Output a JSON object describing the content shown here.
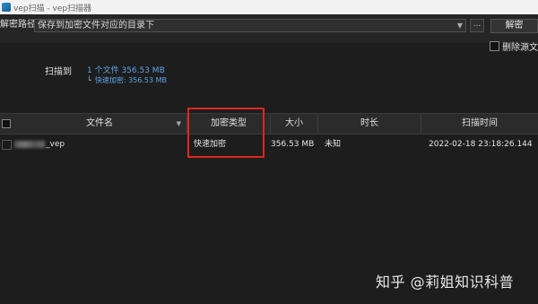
{
  "window": {
    "title": "vep扫描 - vep扫描器"
  },
  "toolbar": {
    "path_label": "解密路径",
    "path_value": "保存到加密文件对应的目录下",
    "browse_label": "...",
    "decrypt_label": "解密",
    "delete_source_label": "删除源文件"
  },
  "scan": {
    "label": "扫描到",
    "summary": "1 个文件   356.53 MB",
    "fast_encrypt": "快速加密: 356.53 MB"
  },
  "table": {
    "columns": [
      "文件名",
      "加密类型",
      "大小",
      "时长",
      "扫描时间"
    ],
    "rows": [
      {
        "name_suffix": "_vep",
        "encrypt_type": "快速加密",
        "size": "356.53 MB",
        "duration": "未知",
        "scan_time": "2022-02-18 23:18:26.144"
      }
    ]
  },
  "watermark": "知乎 @莉姐知识科普"
}
